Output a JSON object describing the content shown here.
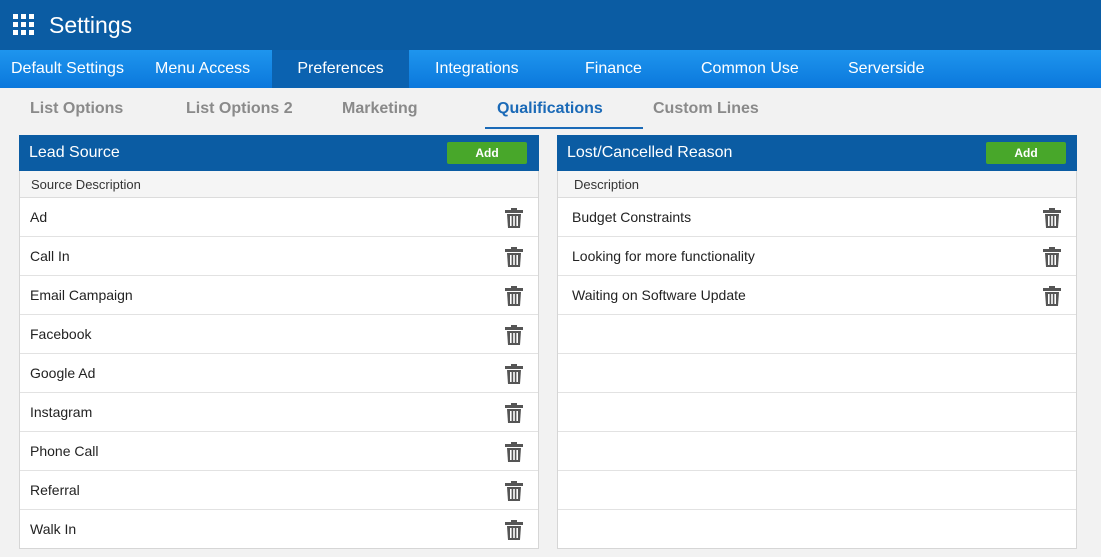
{
  "window": {
    "title": "Settings",
    "apps_icon": "apps-grid-icon"
  },
  "menu": {
    "items": [
      {
        "label": "Default Settings",
        "active": false
      },
      {
        "label": "Menu Access",
        "active": false
      },
      {
        "label": "Preferences",
        "active": true
      },
      {
        "label": "Integrations",
        "active": false
      },
      {
        "label": "Finance",
        "active": false
      },
      {
        "label": "Common Use",
        "active": false
      },
      {
        "label": "Serverside",
        "active": false
      }
    ]
  },
  "subtabs": {
    "items": [
      {
        "label": "List Options",
        "active": false
      },
      {
        "label": "List Options 2",
        "active": false
      },
      {
        "label": "Marketing",
        "active": false
      },
      {
        "label": "Qualifications",
        "active": true
      },
      {
        "label": "Custom Lines",
        "active": false
      }
    ]
  },
  "lead_source": {
    "title": "Lead Source",
    "add_label": "Add",
    "column": "Source Description",
    "rows": [
      "Ad",
      "Call In",
      "Email Campaign",
      "Facebook",
      "Google Ad",
      "Instagram",
      "Phone Call",
      "Referral",
      "Walk In"
    ],
    "row_icon": "trash-icon"
  },
  "lost_reason": {
    "title": "Lost/Cancelled Reason",
    "add_label": "Add",
    "column": "Description",
    "rows": [
      "Budget Constraints",
      "Looking for more functionality",
      "Waiting on Software Update",
      "",
      "",
      "",
      "",
      "",
      ""
    ],
    "row_icon": "trash-icon"
  },
  "colors": {
    "title_bar": "#0b5ca3",
    "menu_bar": "#1e95ee",
    "menu_active": "#0b62b0",
    "subtab_active": "#1b6ab7",
    "add_button": "#48a72a"
  }
}
